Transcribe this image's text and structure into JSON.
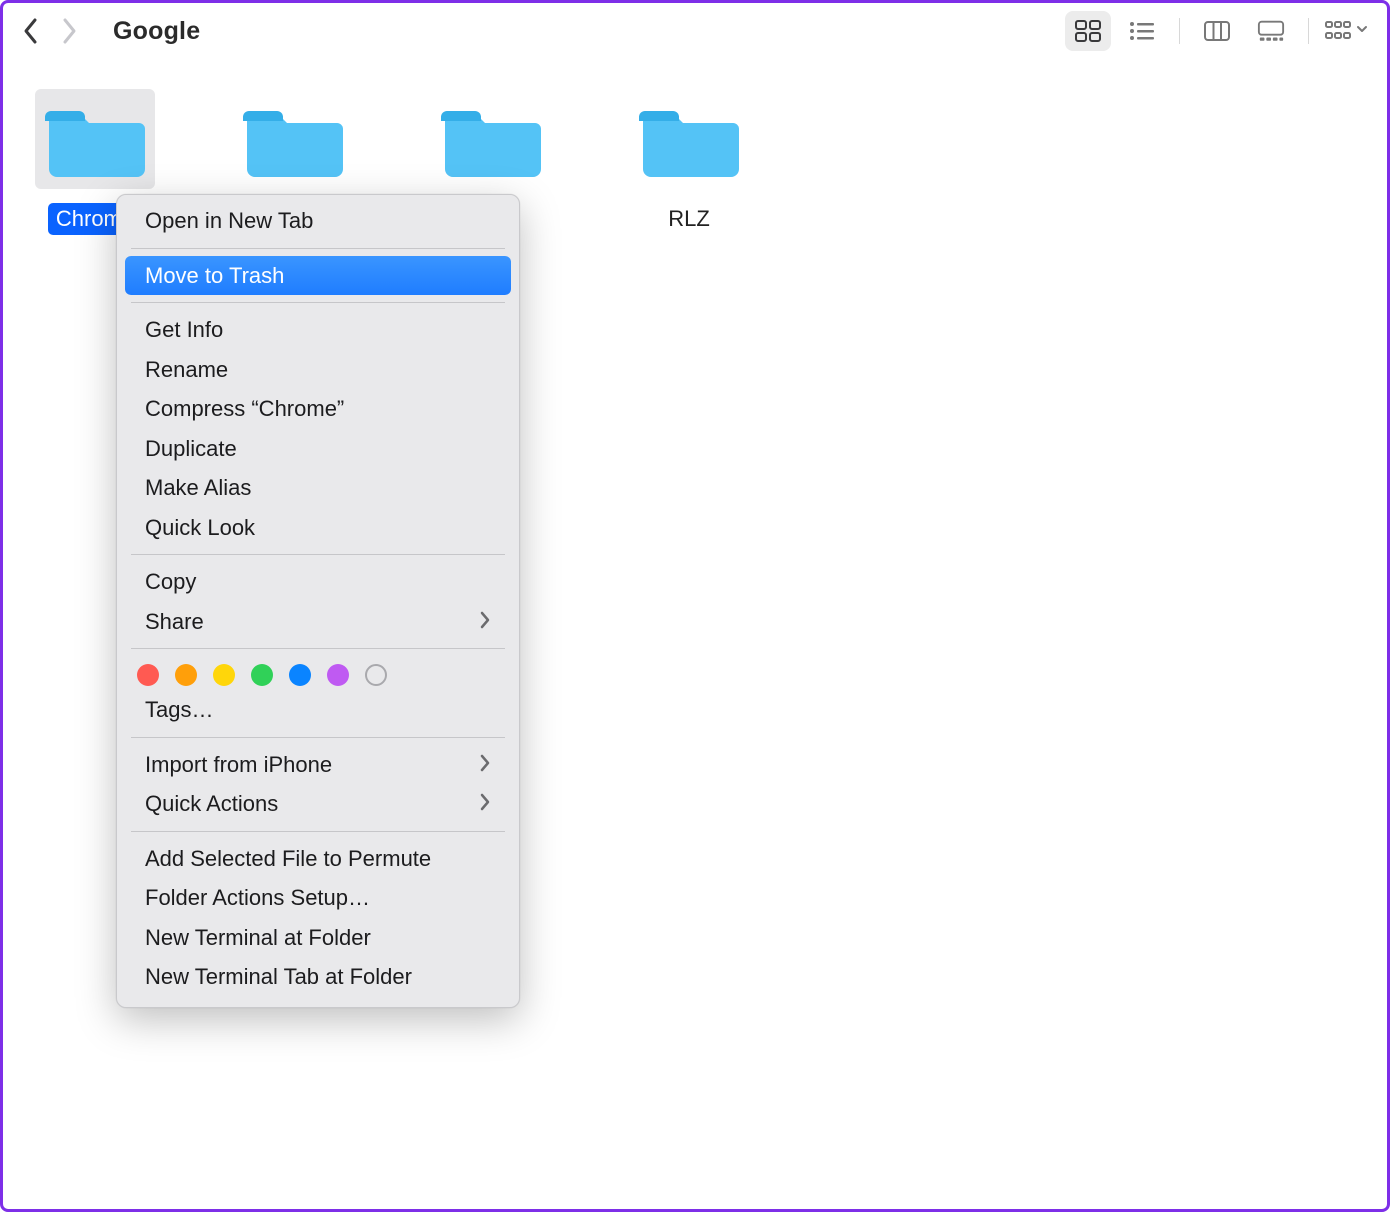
{
  "window": {
    "title": "Google"
  },
  "folders": [
    {
      "name": "Chrome",
      "selected": true
    },
    {
      "name": "",
      "selected": false
    },
    {
      "name": "",
      "selected": false
    },
    {
      "name": "RLZ",
      "selected": false
    }
  ],
  "context_menu": {
    "open_new_tab": "Open in New Tab",
    "move_to_trash": "Move to Trash",
    "get_info": "Get Info",
    "rename": "Rename",
    "compress": "Compress “Chrome”",
    "duplicate": "Duplicate",
    "make_alias": "Make Alias",
    "quick_look": "Quick Look",
    "copy": "Copy",
    "share": "Share",
    "tags": "Tags…",
    "import_iphone": "Import from iPhone",
    "quick_actions": "Quick Actions",
    "add_permute": "Add Selected File to Permute",
    "folder_actions": "Folder Actions Setup…",
    "new_terminal": "New Terminal at Folder",
    "new_terminal_tab": "New Terminal Tab at Folder"
  },
  "tag_colors": [
    "#ff5a52",
    "#ff9f0a",
    "#ffd60a",
    "#30d158",
    "#0a84ff",
    "#bf5af2"
  ]
}
